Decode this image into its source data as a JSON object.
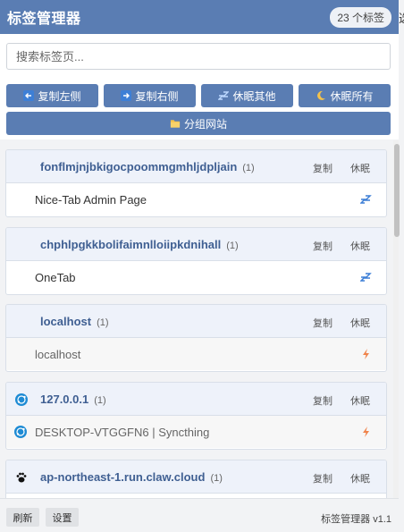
{
  "header": {
    "title": "标签管理器",
    "badge": "23 个标签"
  },
  "edge_fragment": "选",
  "search": {
    "placeholder": "搜索标签页..."
  },
  "toolbar": [
    {
      "label": "复制左侧",
      "icon": "arrow-left-icon"
    },
    {
      "label": "复制右侧",
      "icon": "arrow-right-icon"
    },
    {
      "label": "休眠其他",
      "icon": "sleep-zz-icon"
    },
    {
      "label": "休眠所有",
      "icon": "moon-icon"
    }
  ],
  "group_sites": {
    "label": "分组网站",
    "icon": "folder-icon"
  },
  "group_actions": {
    "copy": "复制",
    "sleep": "休眠"
  },
  "groups": [
    {
      "name": "fonflmjnjbkigocpoommgmhljdpljain",
      "count": "(1)",
      "icon": "none",
      "tabs": [
        {
          "title": "Nice-Tab Admin Page",
          "icon": "none",
          "status": "sleeping-zz-icon"
        }
      ]
    },
    {
      "name": "chphlpgkkbolifaimnlloiipkdnihall",
      "count": "(1)",
      "icon": "none",
      "tabs": [
        {
          "title": "OneTab",
          "icon": "none",
          "status": "sleeping-zz-icon"
        }
      ]
    },
    {
      "name": "localhost",
      "count": "(1)",
      "icon": "none",
      "tabs": [
        {
          "title": "localhost",
          "icon": "none",
          "status": "active-bolt-icon"
        }
      ]
    },
    {
      "name": "127.0.0.1",
      "count": "(1)",
      "icon": "syncthing-icon",
      "tabs": [
        {
          "title": "DESKTOP-VTGGFN6 | Syncthing",
          "icon": "syncthing-icon",
          "status": "active-bolt-icon"
        }
      ]
    },
    {
      "name": "ap-northeast-1.run.claw.cloud",
      "count": "(1)",
      "icon": "paw-icon",
      "tabs": []
    }
  ],
  "footer": {
    "refresh": "刷新",
    "settings": "设置",
    "version": "标签管理器 v1.1"
  },
  "colors": {
    "accent": "#5a7db3",
    "group_header": "#eef2fa",
    "group_name": "#3f5f92",
    "bolt": "#f0834a",
    "zz": "#3d7fd6"
  }
}
